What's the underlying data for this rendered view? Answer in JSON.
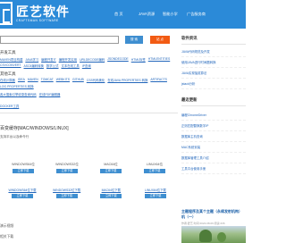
{
  "header": {
    "logo_title": "匠艺软件",
    "logo_subtitle": "CRAFTSMAN SOFTWARE",
    "nav": [
      "首 页",
      "JAVA资源",
      "智能小学",
      "广告服务商"
    ]
  },
  "search": {
    "placeholder": "",
    "search_label": "搜 索",
    "site_label": "站 点"
  },
  "tools_panel": {
    "title": "开发工具",
    "tags": [
      "MAVEN项目构建",
      "JAVA学习",
      "编程开发IT",
      "编程开发实用",
      "URLDECODE编码",
      "JSONDECODE",
      "HTML标签",
      "HTMLENTITIES",
      "CSVCONVERT",
      "ASCII编码转换",
      "数学公式",
      "文本在线工具",
      "IP查询"
    ]
  },
  "tools_panel2": {
    "title": "其他工具",
    "tags": [
      "在线计算器",
      "IDEA",
      "MAVEN",
      "TOMCAT",
      "WEBKITS",
      "GITHUB",
      "CSS代码美化",
      "在线JAVA PROPERTIES 转换",
      "ARTIFACTS",
      "LOG PROPERTIES 转换"
    ]
  },
  "tools_panel3": {
    "title": "",
    "tags": [
      "各大搜索引擎收录查询代码",
      "在线PDF编辑器"
    ]
  },
  "tools_panel4": {
    "title": "",
    "tags": [
      "DOCKER工具"
    ]
  },
  "downloads_section": {
    "title": "百变缓存[MAC/WINDOWS/LINUX]",
    "subtitle": "支持平台以及命令行",
    "items": [
      {
        "name": "WINDOWS64位",
        "button": "立即下载"
      },
      {
        "name": "WINDOWS32位",
        "button": "立即下载"
      },
      {
        "name": "MAC64位",
        "button": "立即下载"
      },
      {
        "name": "LINUX64位",
        "button": "立即下载"
      }
    ],
    "links": [
      {
        "name": "WINDOWS64位下载",
        "button": "立即下载"
      },
      {
        "name": "WINDOWS32位下载",
        "button": "立即下载"
      },
      {
        "name": "MAC64位下载",
        "button": "立即下载"
      },
      {
        "name": "LINUX64位下载",
        "button": "立即下载"
      }
    ],
    "video_label": "演示视频",
    "more_label": "相关下载"
  },
  "sidebar": {
    "friends_title": "软件资讯",
    "friends": [
      "JAVA代码规范及开发",
      "使用JAVA进行时间戳转换",
      "JAVA实现抽奖算法",
      "jstack分析"
    ],
    "latest_title": "最近更新",
    "latest": [
      "编程ChromeDriver",
      "正则匹配替换数字IP",
      "数据库主机查询",
      "MAC系统安装",
      "数据库管理工具介绍",
      "工具平台使用手册"
    ],
    "article_title": "主题程序及某个主题（永续发射机构）",
    "article_title2": "机（一）",
    "article_meta": "作者:匠艺  时间:2024-08-09  阅读:236"
  }
}
